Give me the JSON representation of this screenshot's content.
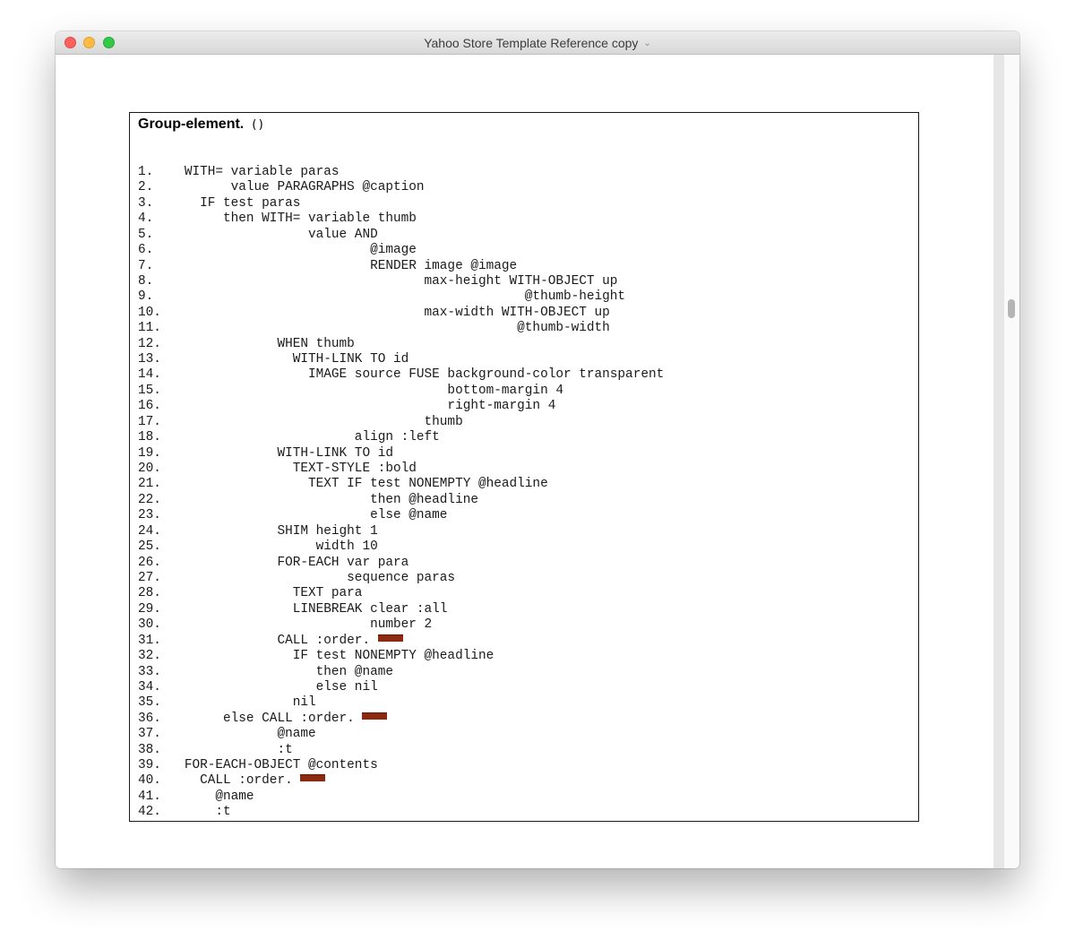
{
  "window": {
    "title": "Yahoo Store Template Reference copy",
    "title_icon": "chevron-down-icon"
  },
  "colors": {
    "close": "#fc615d",
    "minimize": "#fdbc40",
    "zoom": "#34c84a",
    "redaction": "#8b2a10"
  },
  "doc": {
    "heading_name": "Group-element.",
    "heading_args": "()",
    "lines": [
      {
        "num": "1.",
        "text": "  WITH= variable paras"
      },
      {
        "num": "2.",
        "text": "        value PARAGRAPHS @caption"
      },
      {
        "num": "3.",
        "text": "    IF test paras"
      },
      {
        "num": "4.",
        "text": "       then WITH= variable thumb"
      },
      {
        "num": "5.",
        "text": "                  value AND"
      },
      {
        "num": "6.",
        "text": "                          @image"
      },
      {
        "num": "7.",
        "text": "                          RENDER image @image"
      },
      {
        "num": "8.",
        "text": "                                 max-height WITH-OBJECT up"
      },
      {
        "num": "9.",
        "text": "                                              @thumb-height"
      },
      {
        "num": "10.",
        "text": "                                 max-width WITH-OBJECT up"
      },
      {
        "num": "11.",
        "text": "                                             @thumb-width"
      },
      {
        "num": "12.",
        "text": "              WHEN thumb"
      },
      {
        "num": "13.",
        "text": "                WITH-LINK TO id"
      },
      {
        "num": "14.",
        "text": "                  IMAGE source FUSE background-color transparent"
      },
      {
        "num": "15.",
        "text": "                                    bottom-margin 4"
      },
      {
        "num": "16.",
        "text": "                                    right-margin 4"
      },
      {
        "num": "17.",
        "text": "                                 thumb"
      },
      {
        "num": "18.",
        "text": "                        align :left"
      },
      {
        "num": "19.",
        "text": "              WITH-LINK TO id"
      },
      {
        "num": "20.",
        "text": "                TEXT-STYLE :bold"
      },
      {
        "num": "21.",
        "text": "                  TEXT IF test NONEMPTY @headline"
      },
      {
        "num": "22.",
        "text": "                          then @headline"
      },
      {
        "num": "23.",
        "text": "                          else @name"
      },
      {
        "num": "24.",
        "text": "              SHIM height 1"
      },
      {
        "num": "25.",
        "text": "                   width 10"
      },
      {
        "num": "26.",
        "text": "              FOR-EACH var para"
      },
      {
        "num": "27.",
        "text": "                       sequence paras"
      },
      {
        "num": "28.",
        "text": "                TEXT para"
      },
      {
        "num": "29.",
        "text": "                LINEBREAK clear :all"
      },
      {
        "num": "30.",
        "text": "                          number 2"
      },
      {
        "num": "31.",
        "text": "              CALL :order. ",
        "redacted": true
      },
      {
        "num": "32.",
        "text": "                IF test NONEMPTY @headline"
      },
      {
        "num": "33.",
        "text": "                   then @name"
      },
      {
        "num": "34.",
        "text": "                   else nil"
      },
      {
        "num": "35.",
        "text": "                nil"
      },
      {
        "num": "36.",
        "text": "       else CALL :order. ",
        "redacted": true
      },
      {
        "num": "37.",
        "text": "              @name"
      },
      {
        "num": "38.",
        "text": "              :t"
      },
      {
        "num": "39.",
        "text": "  FOR-EACH-OBJECT @contents"
      },
      {
        "num": "40.",
        "text": "    CALL :order. ",
        "redacted": true
      },
      {
        "num": "41.",
        "text": "      @name"
      },
      {
        "num": "42.",
        "text": "      :t"
      }
    ]
  }
}
